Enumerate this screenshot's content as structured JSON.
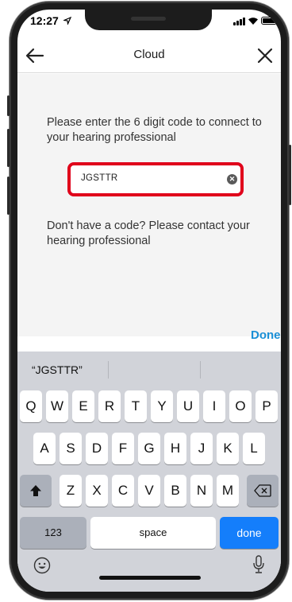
{
  "status_bar": {
    "time": "12:27"
  },
  "nav": {
    "title": "Cloud"
  },
  "content": {
    "instruction": "Please enter the 6 digit code to connect to your hearing professional",
    "code_value": "JGSTTR",
    "help_text": "Don't have a code? Please contact your hearing professional",
    "done_label": "Done"
  },
  "keyboard": {
    "suggestion": "“JGSTTR”",
    "row1": [
      "Q",
      "W",
      "E",
      "R",
      "T",
      "Y",
      "U",
      "I",
      "O",
      "P"
    ],
    "row2": [
      "A",
      "S",
      "D",
      "F",
      "G",
      "H",
      "J",
      "K",
      "L"
    ],
    "row3": [
      "Z",
      "X",
      "C",
      "V",
      "B",
      "N",
      "M"
    ],
    "numbers_label": "123",
    "space_label": "space",
    "done_label": "done"
  },
  "colors": {
    "highlight": "#e0001b",
    "accent": "#1a8fd6",
    "key_blue": "#147efb"
  }
}
